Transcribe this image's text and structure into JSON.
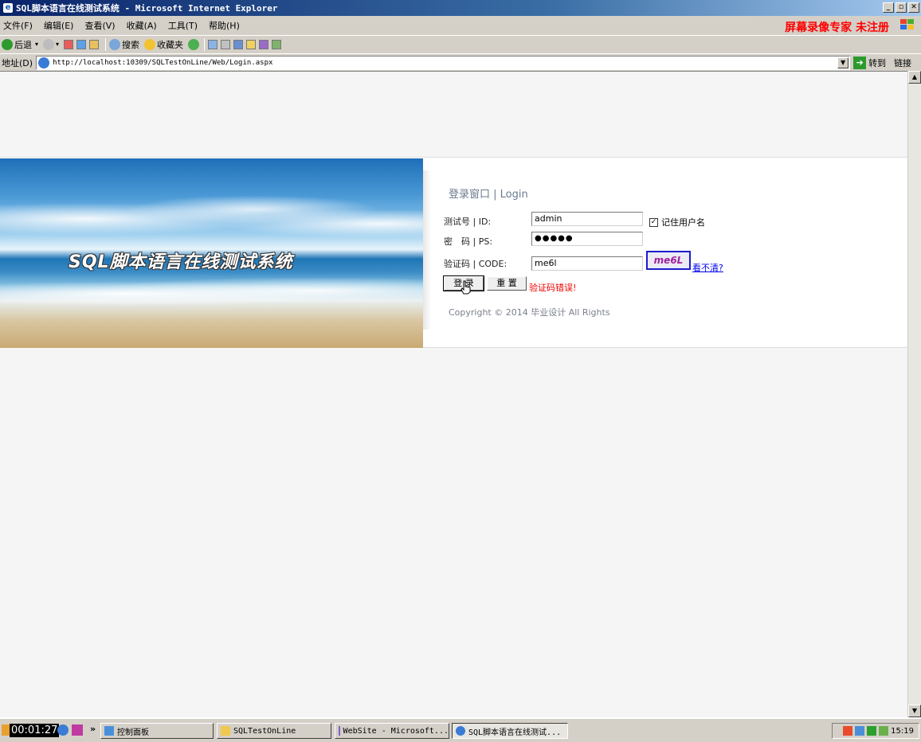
{
  "window": {
    "title": "SQL脚本语言在线测试系统 - Microsoft Internet Explorer",
    "controls": [
      "_",
      "▫",
      "✕"
    ]
  },
  "menubar": {
    "items": [
      "文件(F)",
      "编辑(E)",
      "查看(V)",
      "收藏(A)",
      "工具(T)",
      "帮助(H)"
    ],
    "watermark": "屏幕录像专家  未注册"
  },
  "toolbar": {
    "back": "后退",
    "search": "搜索",
    "favorites": "收藏夹"
  },
  "address": {
    "label": "地址(D)",
    "url": "http://localhost:10309/SQLTestOnLine/Web/Login.aspx",
    "go": "转到",
    "links": "链接"
  },
  "banner": {
    "text": "SQL脚本语言在线测试系统"
  },
  "login": {
    "title": "登录窗口 | Login",
    "id_label": "测试号 | ID:",
    "id_value": "admin",
    "remember_label": "记住用户名",
    "remember_checked": "✓",
    "pw_label": "密　码 | PS:",
    "pw_value": "●●●●●",
    "code_label": "验证码 | CODE:",
    "code_value": "me6l",
    "captcha_text": "me6L",
    "refresh_label": "看不清?",
    "login_button": "登 录",
    "reset_button": "重 置",
    "error": "验证码错误!",
    "copyright": "Copyright © 2014 毕业设计  All Rights"
  },
  "taskbar": {
    "timer": "00:01:27",
    "overflow": "»",
    "buttons": [
      {
        "label": "控制面板"
      },
      {
        "label": "SQLTestOnLine"
      },
      {
        "label": "WebSite - Microsoft..."
      },
      {
        "label": "SQL脚本语言在线测试..."
      }
    ],
    "clock": "15:19"
  }
}
